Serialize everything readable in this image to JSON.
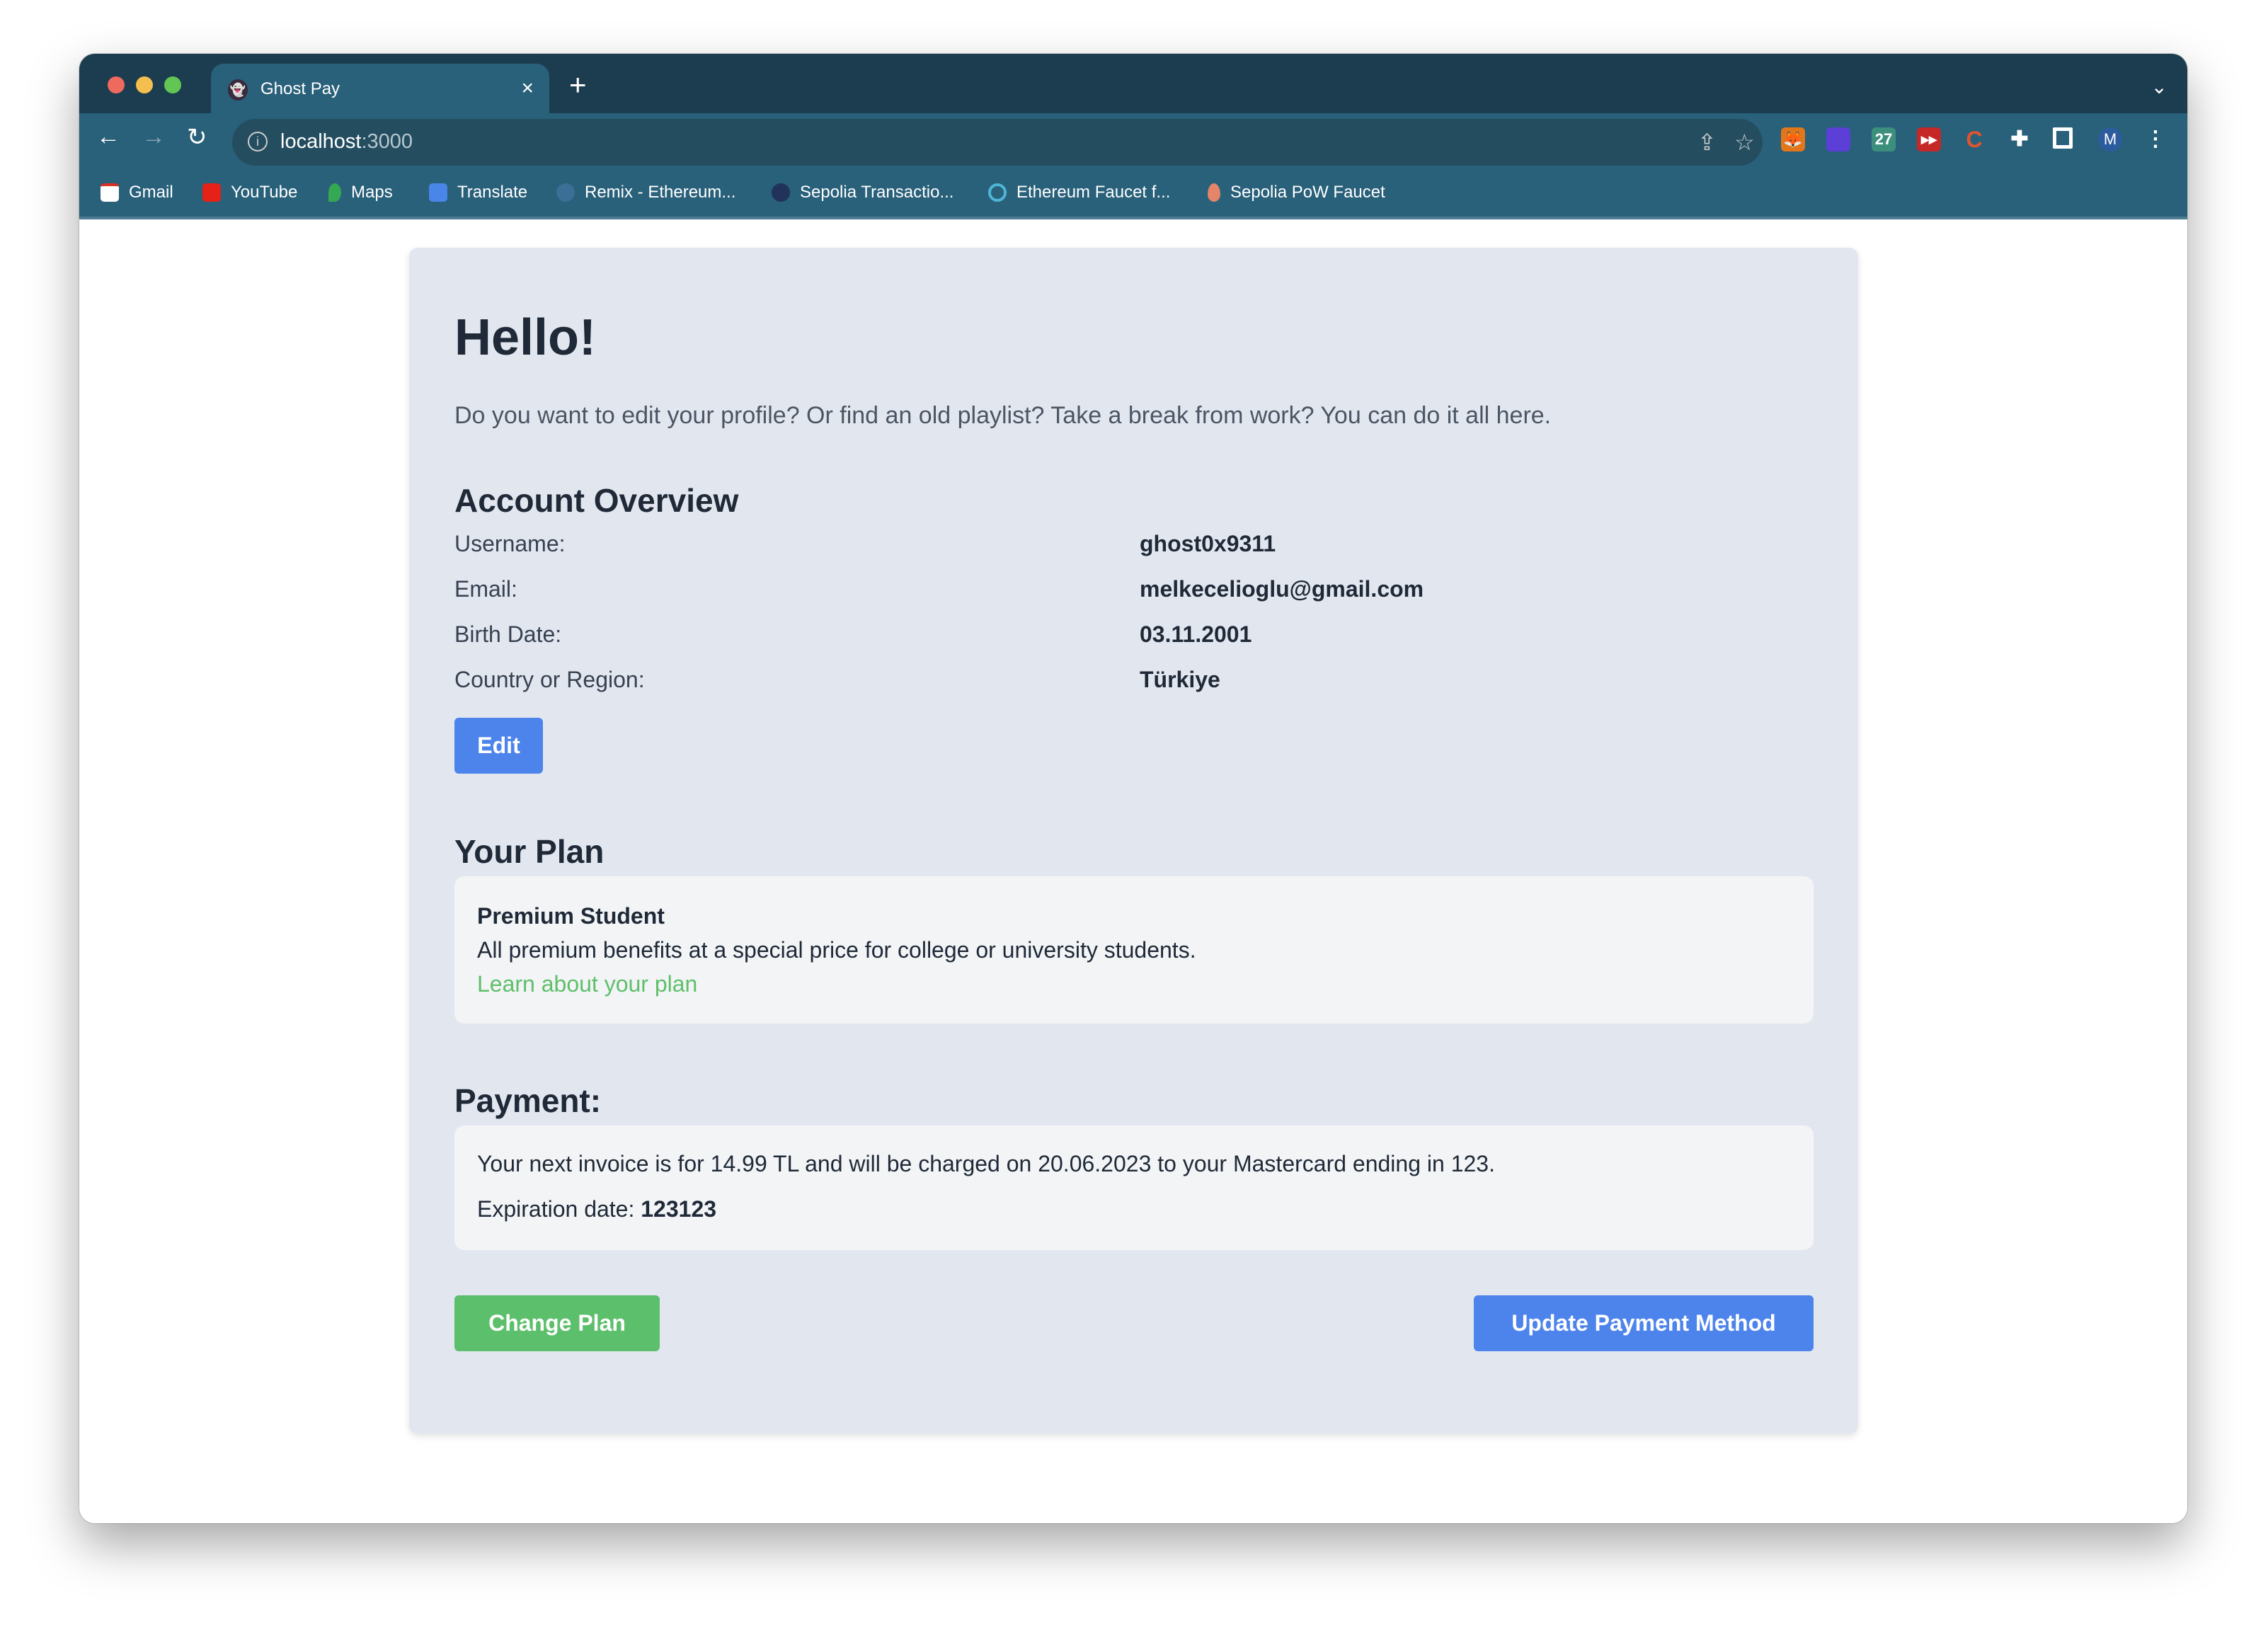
{
  "browser": {
    "tab_title": "Ghost Pay",
    "tab_close": "×",
    "new_tab": "+",
    "url_host": "localhost",
    "url_port": ":3000",
    "bookmarks": [
      "Gmail",
      "YouTube",
      "Maps",
      "Translate",
      "Remix - Ethereum...",
      "Sepolia Transactio...",
      "Ethereum Faucet f...",
      "Sepolia PoW Faucet"
    ],
    "profile_initial": "M",
    "ext_calendar": "27"
  },
  "page": {
    "greeting": "Hello!",
    "intro": "Do you want to edit your profile? Or find an old playlist? Take a break from work? You can do it all here.",
    "account": {
      "title": "Account Overview",
      "rows": [
        {
          "label": "Username:",
          "value": "ghost0x9311"
        },
        {
          "label": "Email:",
          "value": "melkecelioglu@gmail.com"
        },
        {
          "label": "Birth Date:",
          "value": "03.11.2001"
        },
        {
          "label": "Country or Region:",
          "value": "Türkiye"
        }
      ],
      "edit_label": "Edit"
    },
    "plan": {
      "title": "Your Plan",
      "name": "Premium Student",
      "description": "All premium benefits at a special price for college or university students.",
      "link": "Learn about your plan"
    },
    "payment": {
      "title": "Payment:",
      "invoice": "Your next invoice is for 14.99 TL and will be charged on 20.06.2023 to your Mastercard ending in 123.",
      "expiration_label": "Expiration date:",
      "expiration_value": "123123"
    },
    "change_plan_label": "Change Plan",
    "update_payment_label": "Update Payment Method"
  },
  "colors": {
    "primary": "#4d84ec",
    "success": "#5cbf6b",
    "card": "#e2e7ef"
  }
}
